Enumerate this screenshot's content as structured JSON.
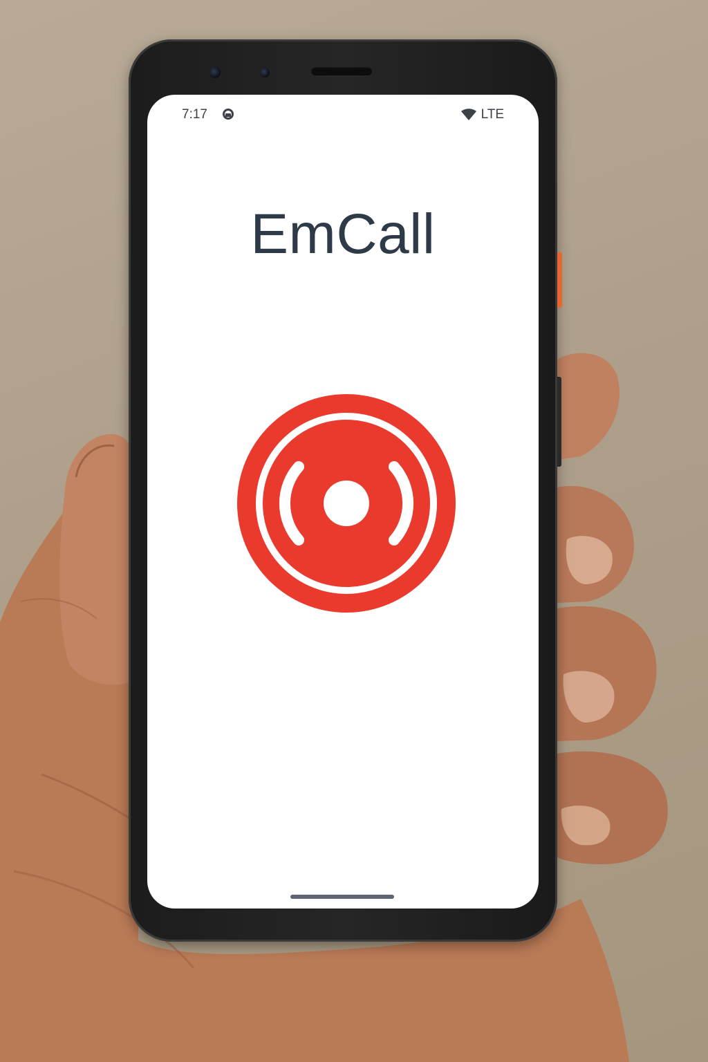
{
  "status_bar": {
    "time": "7:17",
    "notification_icon": "assistant-icon",
    "wifi_icon": "wifi-icon",
    "network": "LTE"
  },
  "app": {
    "title": "EmCall"
  },
  "emergency_button": {
    "icon": "alarm-signal-icon",
    "color": "#ea3a2e"
  },
  "colors": {
    "accent": "#ea3a2e",
    "title_text": "#2f3a48",
    "screen_background": "#ffffff",
    "phone_body": "#1f1f1f",
    "side_button": "#e8652f"
  }
}
